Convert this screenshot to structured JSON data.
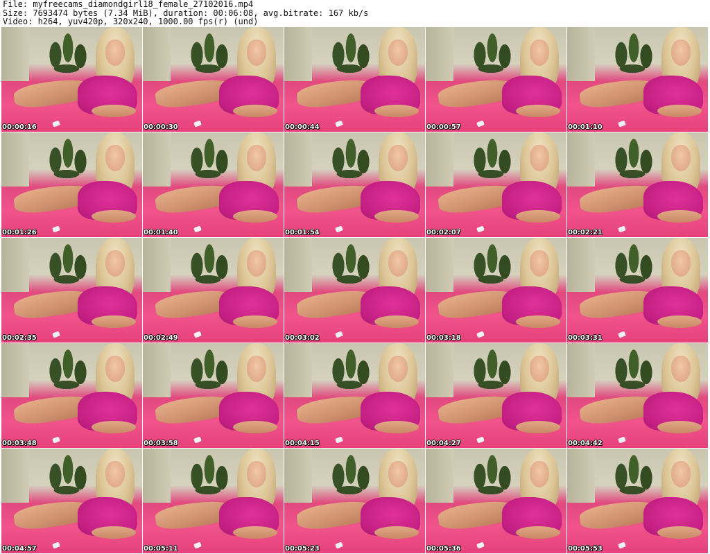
{
  "header": {
    "line1": "File: myfreecams_diamondgirl18_female_27102016.mp4",
    "line2": "Size: 7693474 bytes (7.34 MiB), duration: 00:06:08, avg.bitrate: 167 kb/s",
    "line3": "Video: h264, yuv420p, 320x240, 1000.00 fps(r) (und)"
  },
  "thumbnails": [
    "00:00:16",
    "00:00:30",
    "00:00:44",
    "00:00:57",
    "00:01:10",
    "00:01:26",
    "00:01:40",
    "00:01:54",
    "00:02:07",
    "00:02:21",
    "00:02:35",
    "00:02:49",
    "00:03:02",
    "00:03:18",
    "00:03:31",
    "00:03:48",
    "00:03:58",
    "00:04:15",
    "00:04:27",
    "00:04:42",
    "00:04:57",
    "00:05:11",
    "00:05:23",
    "00:05:36",
    "00:05:53"
  ]
}
